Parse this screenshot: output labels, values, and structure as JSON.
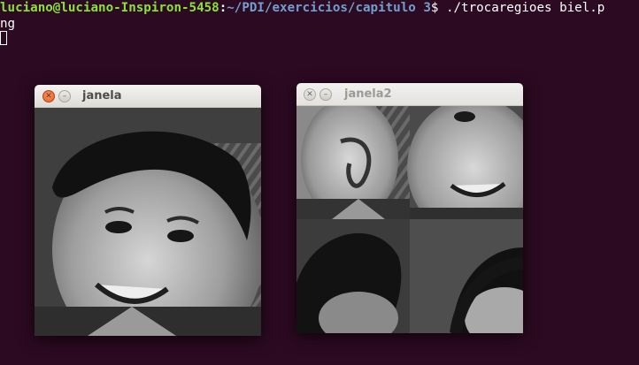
{
  "terminal": {
    "prompt_user": "luciano@luciano-Inspiron-5458",
    "prompt_sep": ":",
    "prompt_path": "~/PDI/exercicios/capitulo 3",
    "prompt_dollar": "$",
    "command_line1": " ./trocaregioes biel.p",
    "command_line2": "ng"
  },
  "windows": [
    {
      "title": "janela",
      "active": true,
      "close_icon": "close-icon",
      "minimize_icon": "minimize-icon"
    },
    {
      "title": "janela2",
      "active": false,
      "close_icon": "close-icon",
      "minimize_icon": "minimize-icon"
    }
  ],
  "colors": {
    "terminal_bg": "#2c0a22",
    "prompt_user": "#8ae234",
    "prompt_path": "#729fcf",
    "close_active": "#e25b22"
  }
}
